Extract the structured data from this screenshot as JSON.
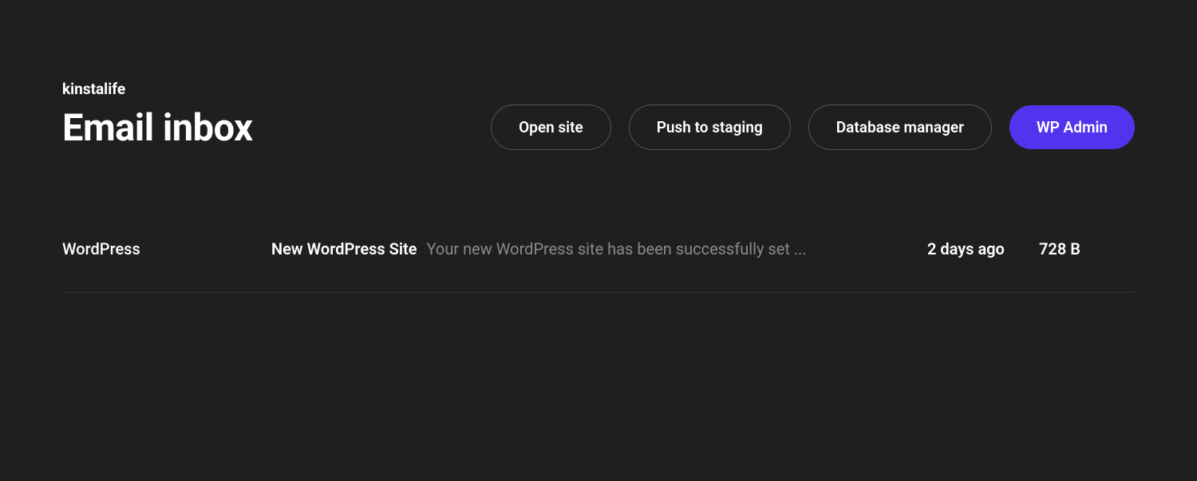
{
  "header": {
    "site_name": "kinstalife",
    "page_title": "Email inbox",
    "actions": {
      "open_site": "Open site",
      "push_to_staging": "Push to staging",
      "database_manager": "Database manager",
      "wp_admin": "WP Admin"
    }
  },
  "emails": [
    {
      "sender": "WordPress",
      "subject": "New WordPress Site",
      "preview": "Your new WordPress site has been successfully set ...",
      "time": "2 days ago",
      "size": "728 B"
    }
  ]
}
